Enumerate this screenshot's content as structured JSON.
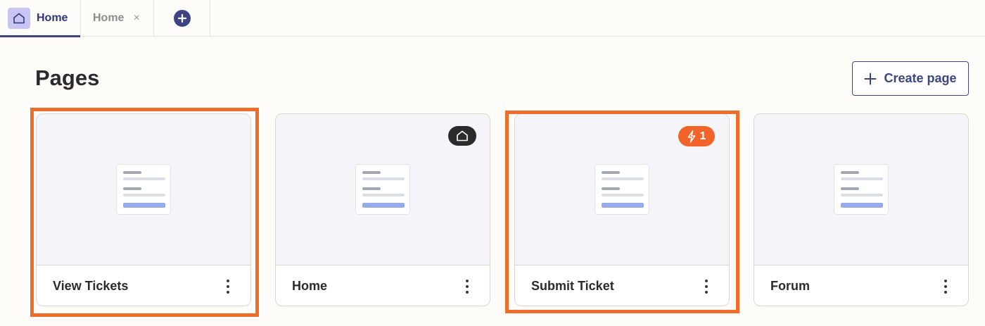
{
  "tabs": [
    {
      "label": "Home",
      "icon": "home-icon",
      "active": true
    },
    {
      "label": "Home",
      "close_icon": "×",
      "active": false
    }
  ],
  "add_tab_icon": "plus-circle-icon",
  "header": {
    "title": "Pages",
    "create_button": "Create page"
  },
  "cards": [
    {
      "name": "View Tickets",
      "badge": null,
      "highlighted": true
    },
    {
      "name": "Home",
      "badge": "home-icon",
      "highlighted": false
    },
    {
      "name": "Submit Ticket",
      "badge": "1",
      "badge_icon": "lightning-icon",
      "highlighted": true
    },
    {
      "name": "Forum",
      "badge": null,
      "highlighted": false
    }
  ],
  "colors": {
    "accent": "#3d4485",
    "tab_icon_bg": "#c9c4f2",
    "highlight": "#ef6c2b",
    "badge_orange": "#f2632a",
    "badge_dark": "#2b2b2b",
    "preview_bg": "#f4f4f9"
  }
}
